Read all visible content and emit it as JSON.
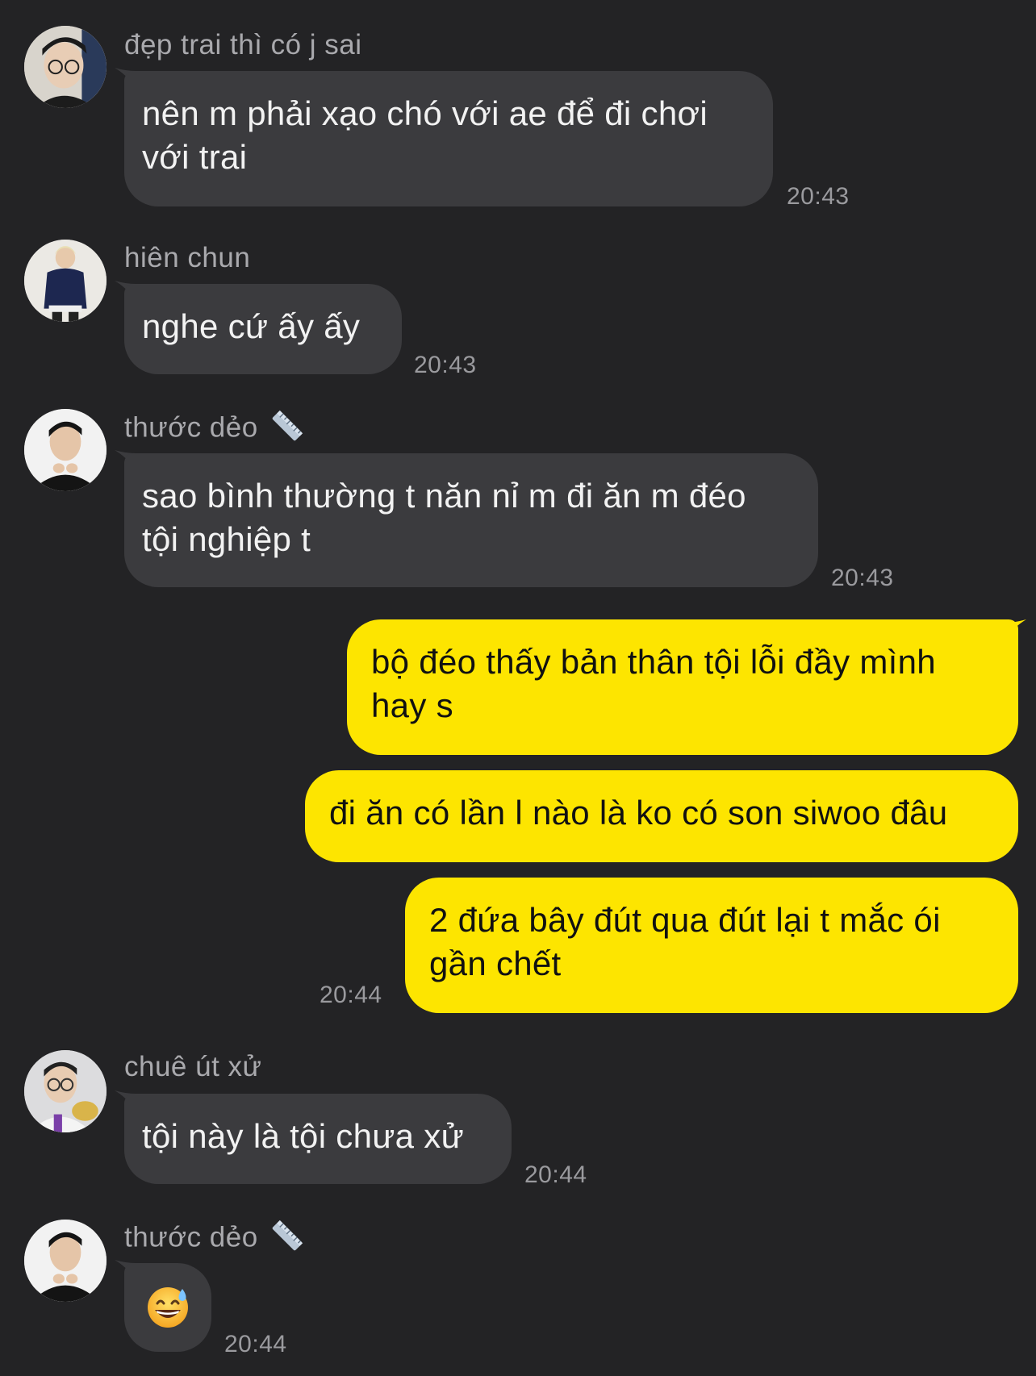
{
  "messages": [
    {
      "sender": "đẹp trai thì có j sai",
      "text": "nên m phải xạo chó với ae để đi chơi\nvới trai",
      "time": "20:43",
      "avatar_icon": "avatar-glasses-boy-icon"
    },
    {
      "sender": "hiên chun",
      "text": "nghe cứ ấy ấy",
      "time": "20:43",
      "avatar_icon": "avatar-blonde-boy-icon"
    },
    {
      "sender": "thước dẻo",
      "text": "sao bình thường t năn nỉ m đi ăn m đéo\ntội nghiệp t",
      "time": "20:43",
      "avatar_icon": "avatar-black-shirt-boy-icon",
      "name_emoji": "ruler-icon"
    },
    {
      "sender": "me",
      "text": "bộ đéo thấy bản thân tội lỗi đầy mình\nhay s"
    },
    {
      "sender": "me",
      "text": "đi ăn có lần l nào là ko có son siwoo đâu"
    },
    {
      "sender": "me",
      "text": "2 đứa bây đút qua đút lại t mắc ói\ngần chết",
      "time": "20:44"
    },
    {
      "sender": "chuê út xử",
      "text": "tội này là tội chưa xử",
      "time": "20:44",
      "avatar_icon": "avatar-glasses-gold-boy-icon"
    },
    {
      "sender": "thước dẻo",
      "text": "",
      "emoji": "grinning-sweat-emoji",
      "time": "20:44",
      "avatar_icon": "avatar-black-shirt-boy-icon",
      "name_emoji": "ruler-icon"
    }
  ],
  "colors": {
    "background": "#232325",
    "incoming_bubble": "#3b3b3e",
    "outgoing_bubble": "#fde500",
    "sender_name": "#a9a9ad",
    "timestamp": "#9a9a9e"
  }
}
